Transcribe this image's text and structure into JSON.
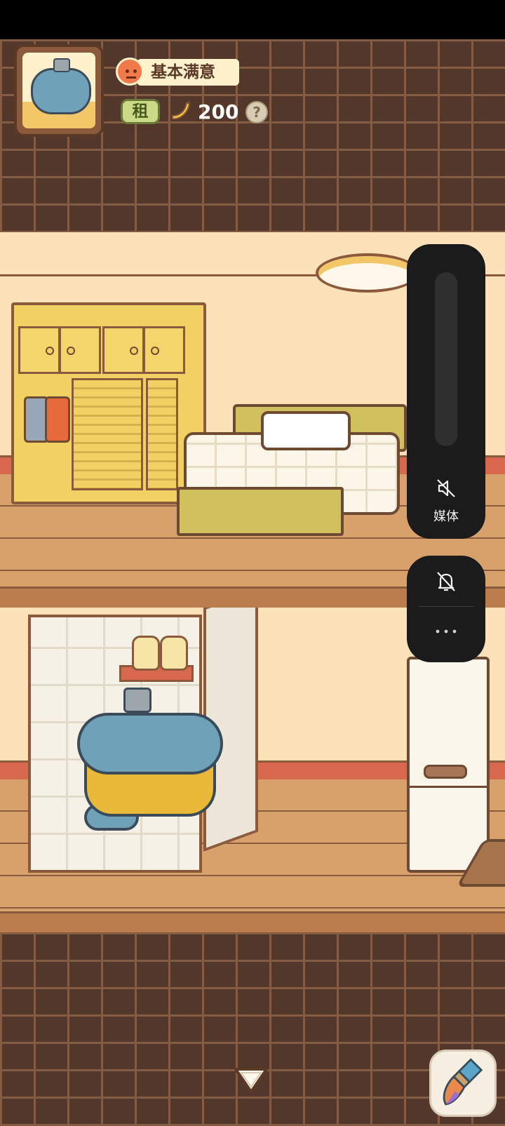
{
  "hud": {
    "status_text": "基本满意",
    "rent_label": "租",
    "banana_count": "200",
    "help_label": "?"
  },
  "volume_overlay": {
    "media_label": "媒体",
    "more_label": "···"
  },
  "icons": {
    "mood": "neutral-face-icon",
    "currency": "banana-icon",
    "media": "speaker-muted-icon",
    "ringer": "bell-muted-icon",
    "scroll": "triangle-down-icon",
    "decorate": "paint-brush-icon"
  },
  "colors": {
    "brick": "#53372a",
    "wall": "#fde2b9",
    "overlay": "#1b1b1b",
    "mood_face": "#f07a4a",
    "rent_badge": "#c9db86"
  }
}
